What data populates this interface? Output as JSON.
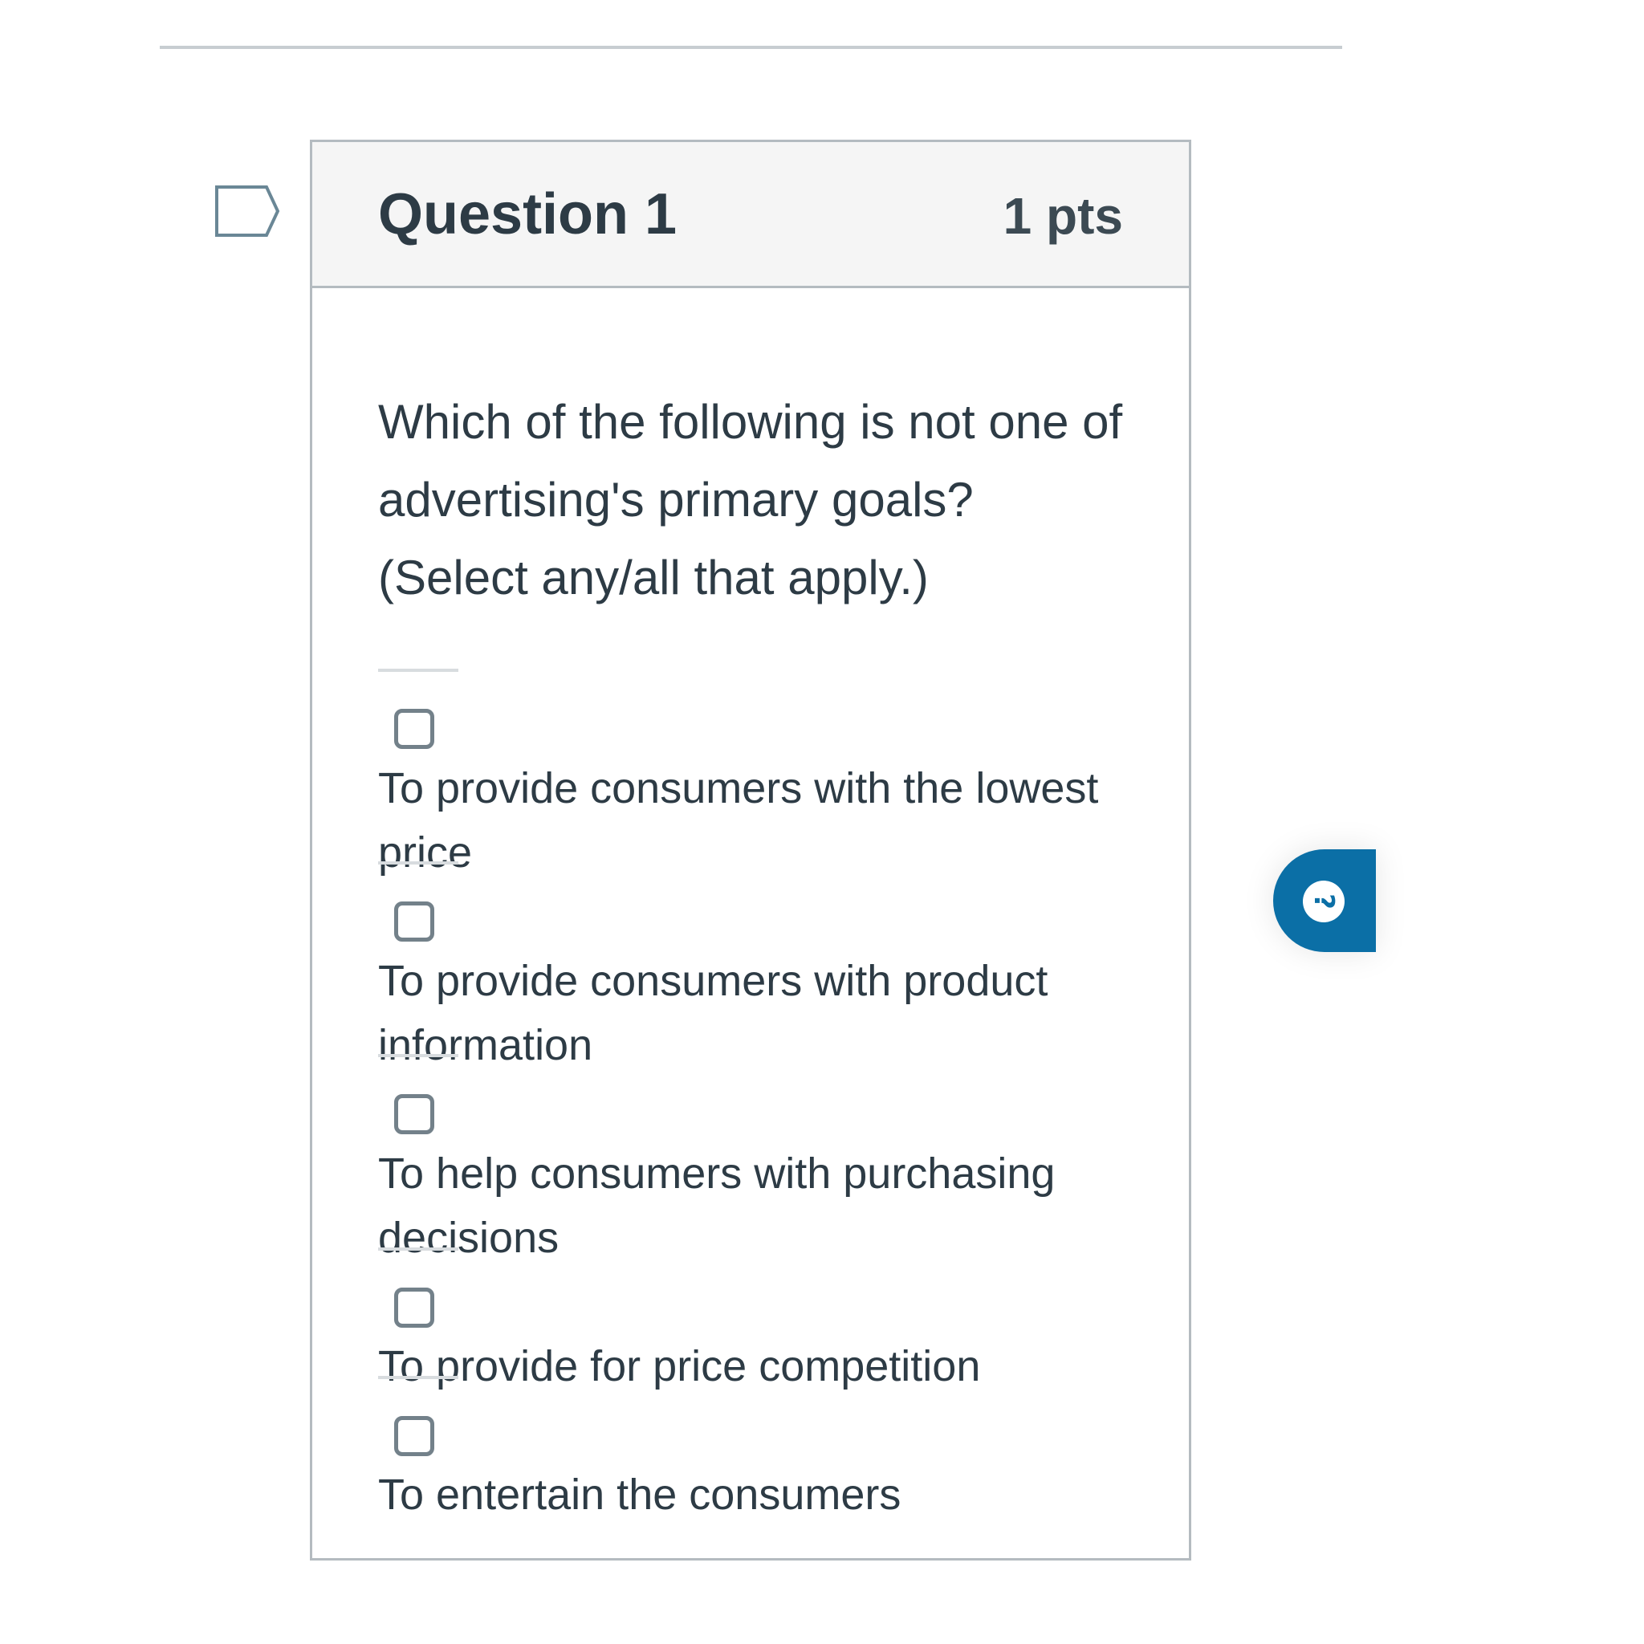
{
  "question": {
    "title": "Question 1",
    "points": "1 pts",
    "text": "Which of the following is not one of advertising's primary goals? (Select any/all that apply.)",
    "answers": [
      "To provide consumers with the lowest price",
      "To provide consumers with product information",
      "To help consumers with purchasing decisions",
      "To provide for price competition",
      "To entertain the consumers"
    ]
  },
  "help": {
    "glyph": "?"
  },
  "icons": {
    "flag": "flag-icon",
    "help": "help-icon"
  },
  "colors": {
    "header_background": "#f5f5f5",
    "border": "#b4bbc0",
    "text": "#2d3b45",
    "help_blue": "#0b6fa6",
    "checkbox_border": "#73818a"
  }
}
